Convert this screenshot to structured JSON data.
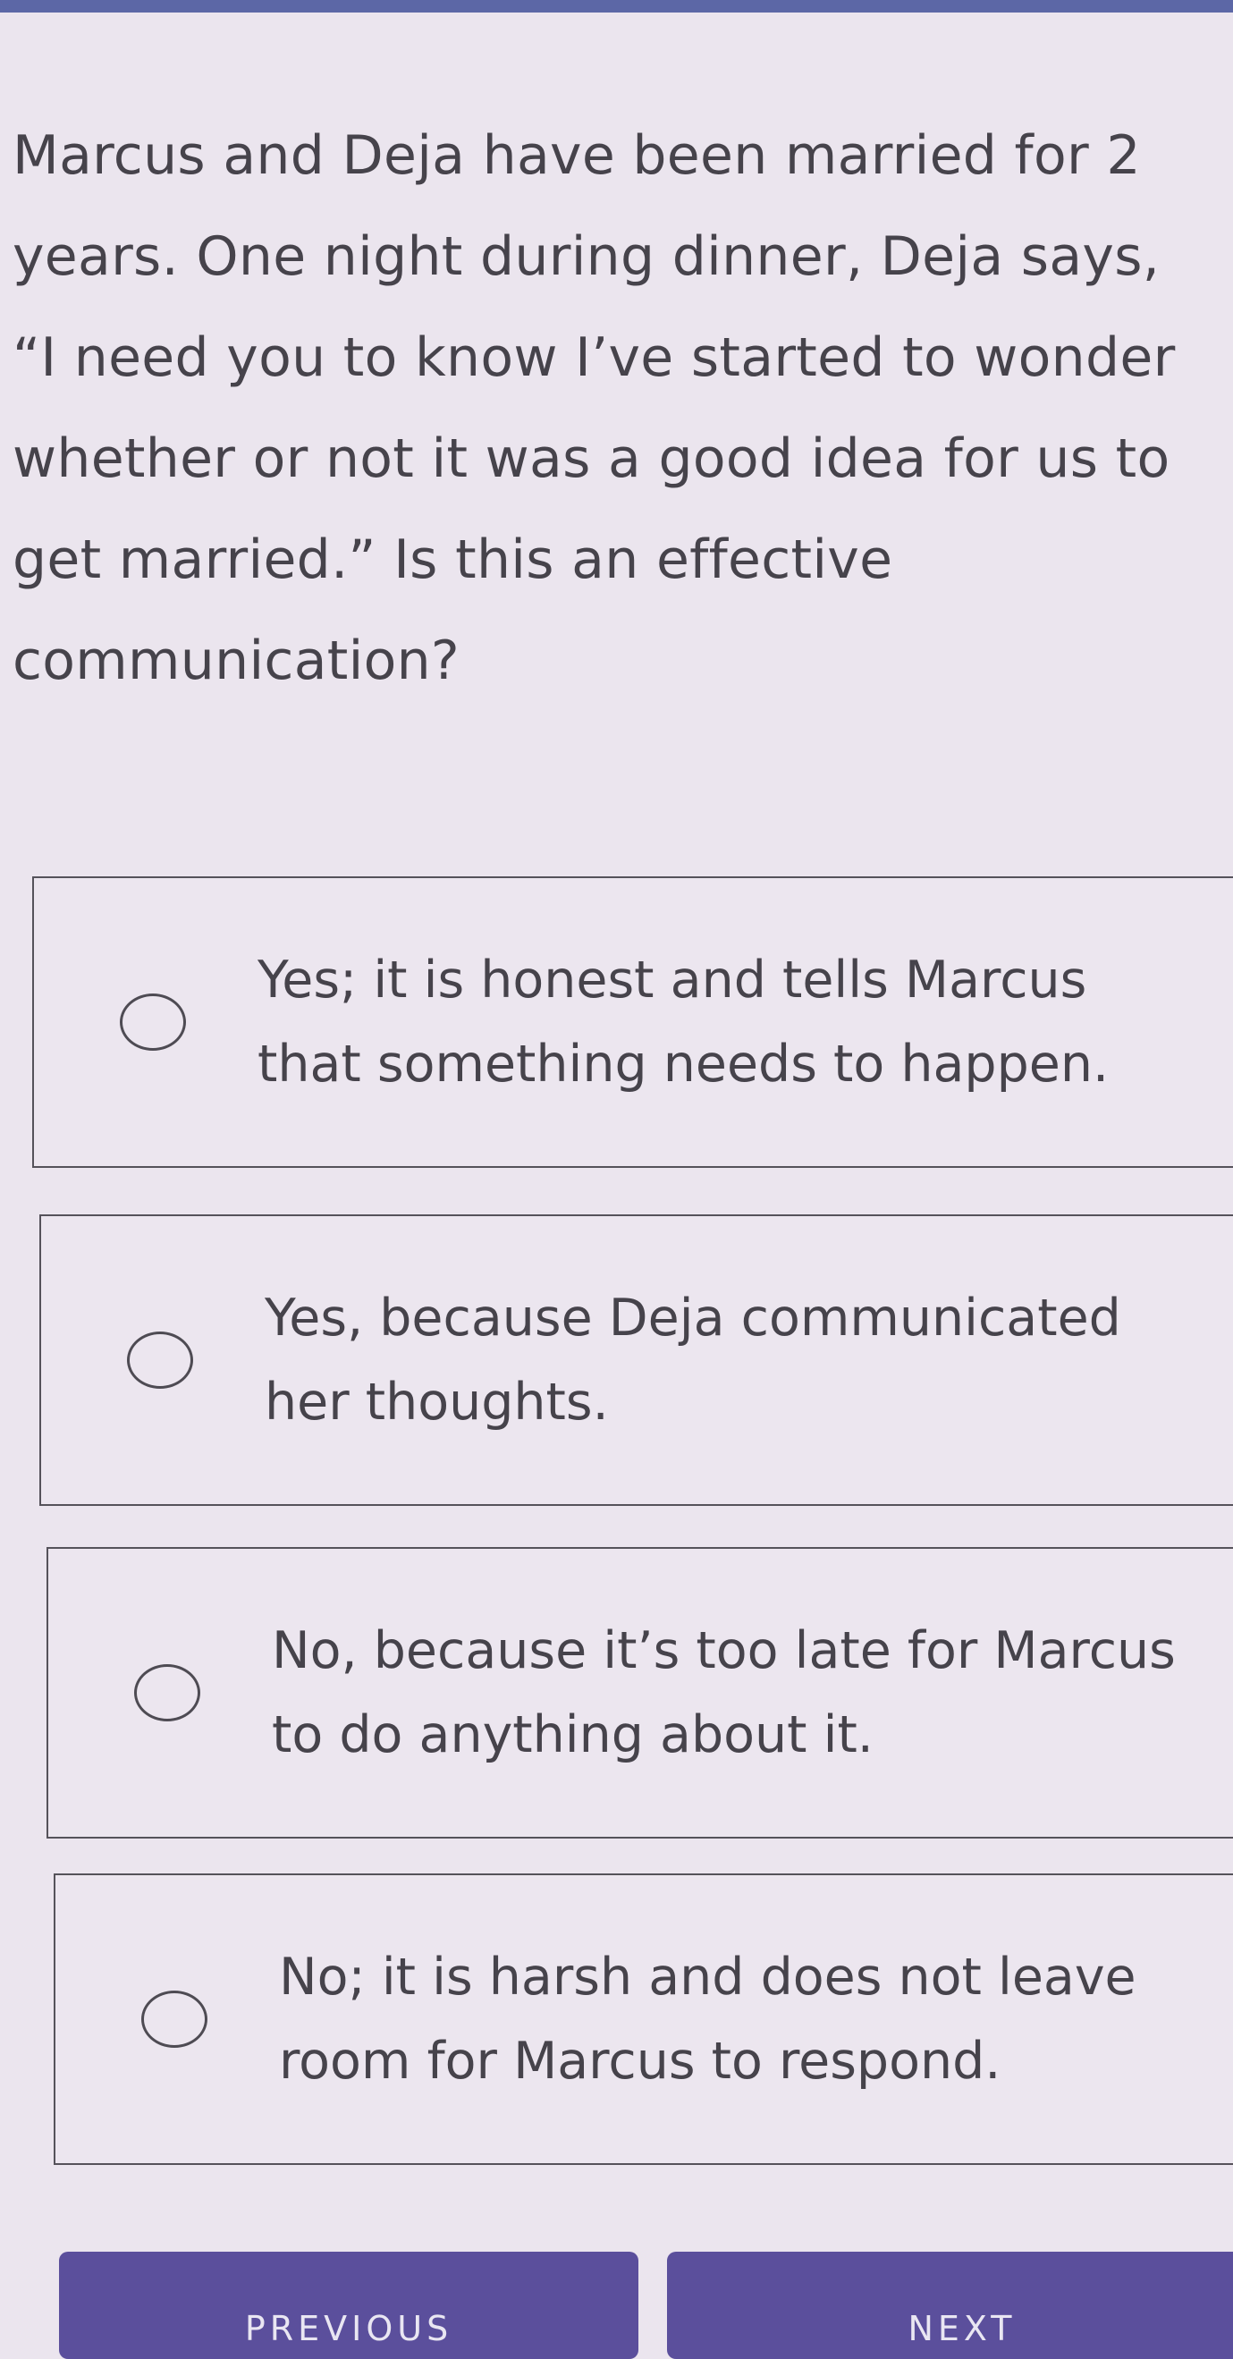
{
  "question": {
    "text": "Marcus and Deja have been married for 2 years. One night during dinner, Deja says, “I need you to know I’ve started to wonder whether or not it was a good idea for us to get married.” Is this an effective communication?"
  },
  "options": [
    {
      "label": "Yes; it is honest and tells Marcus that something needs to happen.",
      "selected": false
    },
    {
      "label": "Yes, because Deja communicated her thoughts.",
      "selected": false
    },
    {
      "label": "No, because it’s too late for Marcus to do anything about it.",
      "selected": false
    },
    {
      "label": "No; it is harsh and does not leave room for Marcus to respond.",
      "selected": false
    }
  ],
  "navigation": {
    "previous_label": "PREVIOUS",
    "next_label": "NEXT"
  },
  "colors": {
    "background": "#ebe5ee",
    "accent_bar": "#5c67a6",
    "button": "#5b4f9c",
    "text": "#46434b"
  }
}
